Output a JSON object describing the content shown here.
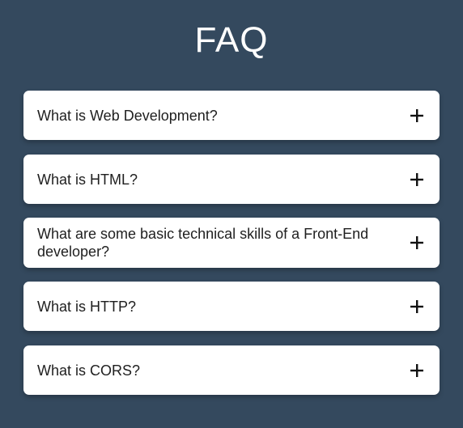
{
  "page": {
    "title": "FAQ"
  },
  "faq": {
    "items": [
      {
        "question": "What is Web Development?",
        "toggle_icon": "plus-icon"
      },
      {
        "question": "What is HTML?",
        "toggle_icon": "plus-icon"
      },
      {
        "question": "What are some basic technical skills of a Front-End developer?",
        "toggle_icon": "plus-icon"
      },
      {
        "question": "What is HTTP?",
        "toggle_icon": "plus-icon"
      },
      {
        "question": "What is CORS?",
        "toggle_icon": "plus-icon"
      }
    ]
  },
  "colors": {
    "background": "#34495e",
    "card": "#ffffff",
    "text": "#1f1f1f",
    "title": "#ffffff"
  }
}
